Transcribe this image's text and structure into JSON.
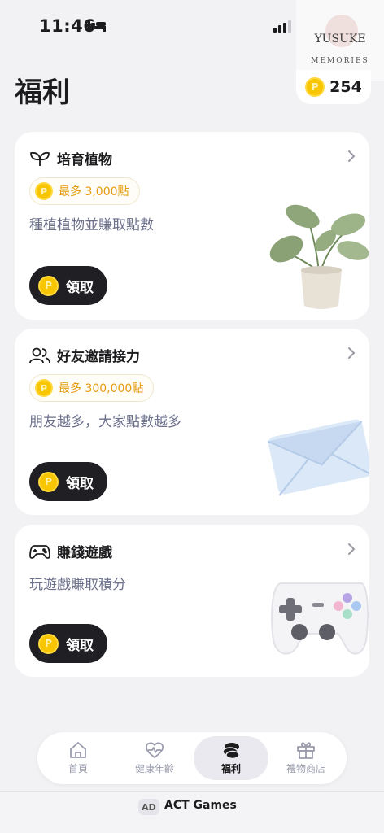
{
  "status_bar": {
    "time": "11:46"
  },
  "watermark": {
    "line1": "YUSUKE",
    "line2": "MEMORIES"
  },
  "header": {
    "title": "福利",
    "points": "254",
    "coin_symbol": "P"
  },
  "cards": [
    {
      "title": "培育植物",
      "bonus": "最多 3,000點",
      "description": "種植植物並賺取點數",
      "button": "領取",
      "icon": "sprout-icon",
      "illustration": "potted-plant"
    },
    {
      "title": "好友邀請接力",
      "bonus": "最多 300,000點",
      "description": "朋友越多，大家點數越多",
      "button": "領取",
      "icon": "friends-icon",
      "illustration": "envelope"
    },
    {
      "title": "賺錢遊戲",
      "description": "玩遊戲賺取積分",
      "button": "領取",
      "icon": "gamepad-icon",
      "illustration": "game-controller"
    }
  ],
  "nav": [
    {
      "label": "首頁",
      "icon": "home-icon"
    },
    {
      "label": "健康年齡",
      "icon": "heart-pulse-icon"
    },
    {
      "label": "福利",
      "icon": "coins-icon",
      "active": true
    },
    {
      "label": "禮物商店",
      "icon": "gift-icon"
    }
  ],
  "ad": {
    "tag": "AD",
    "text": "ACT Games"
  },
  "colors": {
    "accent_coin": "#f7c600",
    "bonus_text": "#e69a10",
    "button_bg": "#1f1f24",
    "description": "#6b6f8a"
  }
}
